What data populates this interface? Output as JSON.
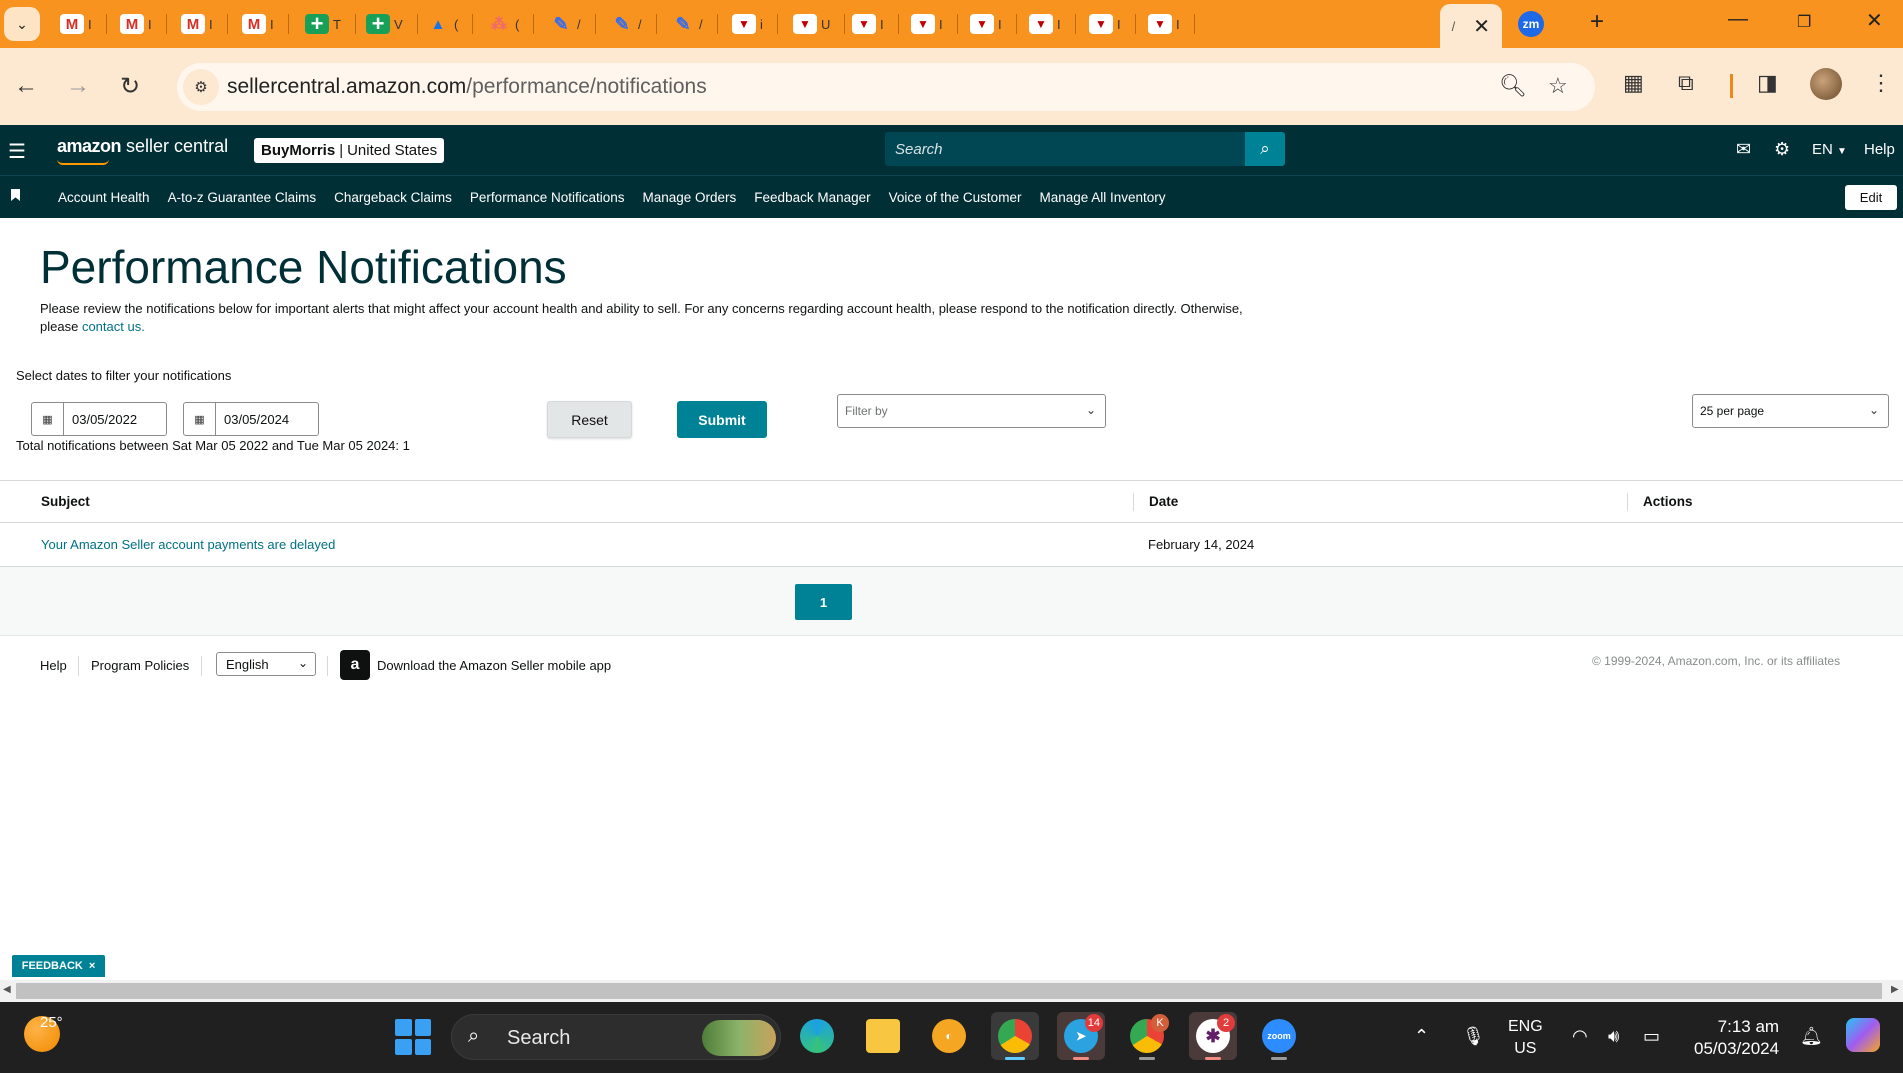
{
  "browser": {
    "tabs": [
      {
        "icon": "gmail-icon",
        "glyph": "M",
        "trail": "I"
      },
      {
        "icon": "gmail-icon",
        "glyph": "M",
        "trail": "I"
      },
      {
        "icon": "gmail-icon",
        "glyph": "M",
        "trail": "I"
      },
      {
        "icon": "gmail-icon",
        "glyph": "M",
        "trail": "I"
      },
      {
        "icon": "sheets-icon",
        "glyph": "+",
        "trail": "T"
      },
      {
        "icon": "sheets-icon",
        "glyph": "+",
        "trail": "V"
      },
      {
        "icon": "drive-icon",
        "glyph": "▲",
        "trail": "("
      },
      {
        "icon": "asana-icon",
        "glyph": "⁂",
        "trail": "("
      },
      {
        "icon": "pen-icon",
        "glyph": "✎",
        "trail": "/"
      },
      {
        "icon": "pen-icon",
        "glyph": "✎",
        "trail": "/"
      },
      {
        "icon": "pen-icon",
        "glyph": "✎",
        "trail": "/"
      },
      {
        "icon": "flag-icon",
        "glyph": "▼",
        "trail": "i"
      },
      {
        "icon": "flag-icon",
        "glyph": "▼",
        "trail": "U"
      },
      {
        "icon": "flag-icon",
        "glyph": "▼",
        "trail": "I"
      },
      {
        "icon": "flag-icon",
        "glyph": "▼",
        "trail": "I"
      },
      {
        "icon": "flag-icon",
        "glyph": "▼",
        "trail": "I"
      },
      {
        "icon": "flag-icon",
        "glyph": "▼",
        "trail": "I"
      },
      {
        "icon": "flag-icon",
        "glyph": "▼",
        "trail": "I"
      },
      {
        "icon": "flag-icon",
        "glyph": "▼",
        "trail": "I"
      }
    ],
    "active_tab_trail": "/",
    "zoom_tab_label": "zm",
    "url_host": "sellercentral.amazon.com",
    "url_path": "/performance/notifications"
  },
  "header": {
    "logo_word": "amazon",
    "logo_rest": " seller central",
    "store_name": "BuyMorris",
    "store_region": "United States",
    "search_placeholder": "Search",
    "lang": "EN",
    "help": "Help"
  },
  "nav": {
    "items": [
      "Account Health",
      "A-to-z Guarantee Claims",
      "Chargeback Claims",
      "Performance Notifications",
      "Manage Orders",
      "Feedback Manager",
      "Voice of the Customer",
      "Manage All Inventory"
    ],
    "edit": "Edit"
  },
  "main": {
    "title": "Performance Notifications",
    "intro": "Please review the notifications below for important alerts that might affect your account health and ability to sell. For any concerns regarding account health, please respond to the notification directly. Otherwise, please",
    "contact_link": "contact us.",
    "filter_label": "Select dates to filter your notifications",
    "start_date": "03/05/2022",
    "end_date": "03/05/2024",
    "reset": "Reset",
    "submit": "Submit",
    "filter_by_placeholder": "Filter by",
    "per_page": "25 per page",
    "totals": "Total notifications between Sat Mar 05 2022 and Tue Mar 05 2024: 1"
  },
  "table": {
    "columns": [
      "Subject",
      "Date",
      "Actions"
    ],
    "rows": [
      {
        "subject": "Your Amazon Seller account payments are delayed",
        "date": "February 14, 2024",
        "actions": ""
      }
    ]
  },
  "pagination": {
    "current_page": "1"
  },
  "footer": {
    "help": "Help",
    "policies": "Program Policies",
    "language": "English",
    "app_text": "Download the Amazon Seller mobile app",
    "copyright": "© 1999-2024, Amazon.com, Inc. or its affiliates"
  },
  "feedback": {
    "label": "FEEDBACK",
    "close": "×"
  },
  "taskbar": {
    "temperature": "25°",
    "search_label": "Search",
    "telegram_badge": "14",
    "chrome2_badge": "K",
    "slack_badge": "2",
    "zoom_label": "zoom",
    "lang_line1": "ENG",
    "lang_line2": "US",
    "time": "7:13 am",
    "date": "05/03/2024"
  }
}
